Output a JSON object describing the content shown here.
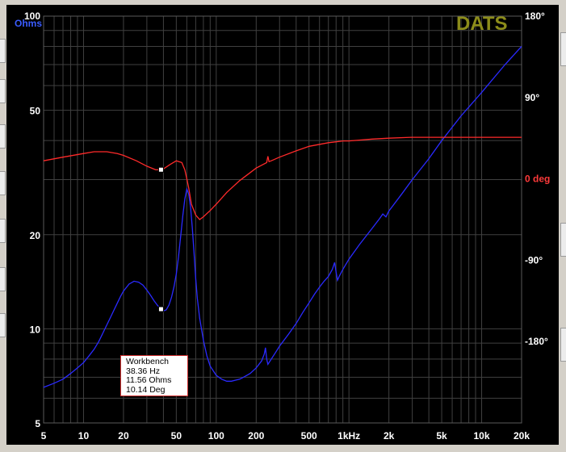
{
  "app": {
    "logo_text": "DATS"
  },
  "colors": {
    "background": "#000000",
    "grid": "#404040",
    "impedance": "#2a2aff",
    "phase": "#ff2a2a",
    "left_label": "#ffffff",
    "ohms_label": "#3a5cff",
    "deg_label": "#ff3a3a",
    "logo": "#8c8c1a"
  },
  "readout": {
    "title": "Workbench",
    "freq": "38.36 Hz",
    "ohms": "11.56 Ohms",
    "deg": "10.14 Deg"
  },
  "chart_data": {
    "type": "line",
    "x_scale": "log",
    "y_scale": "log",
    "xlim": [
      5,
      20000
    ],
    "ylim": [
      5,
      100
    ],
    "y2lim": [
      -270,
      180
    ],
    "grid": true,
    "xlabel": "",
    "ylabel": "Ohms",
    "y2label": "deg",
    "x_tick_labels": [
      {
        "v": 5,
        "t": "5"
      },
      {
        "v": 10,
        "t": "10"
      },
      {
        "v": 20,
        "t": "20"
      },
      {
        "v": 50,
        "t": "50"
      },
      {
        "v": 100,
        "t": "100"
      },
      {
        "v": 200,
        "t": "200"
      },
      {
        "v": 500,
        "t": "500"
      },
      {
        "v": 1000,
        "t": "1kHz"
      },
      {
        "v": 2000,
        "t": "2k"
      },
      {
        "v": 5000,
        "t": "5k"
      },
      {
        "v": 10000,
        "t": "10k"
      },
      {
        "v": 20000,
        "t": "20k"
      }
    ],
    "y_tick_labels": [
      {
        "v": 100,
        "t": "100"
      },
      {
        "v": 50,
        "t": "50"
      },
      {
        "v": 20,
        "t": "20"
      },
      {
        "v": 10,
        "t": "10"
      },
      {
        "v": 5,
        "t": "5"
      }
    ],
    "y2_tick_labels": [
      {
        "v": 180,
        "t": "180°"
      },
      {
        "v": 90,
        "t": "90°"
      },
      {
        "v": 0,
        "t": "0"
      },
      {
        "v": -90,
        "t": "-90°"
      },
      {
        "v": -180,
        "t": "-180°"
      }
    ],
    "series": [
      {
        "name": "Ohms",
        "axis": "left",
        "x": [
          5,
          6,
          7,
          8,
          9,
          10,
          11,
          12,
          13,
          14,
          15,
          16,
          17,
          18,
          19,
          20,
          22,
          24,
          26,
          28,
          30,
          32,
          34,
          36,
          38.36,
          40,
          42,
          44,
          46,
          48,
          50,
          52,
          54,
          56,
          58,
          60,
          62,
          64,
          66,
          68,
          70,
          72,
          75,
          80,
          85,
          90,
          100,
          110,
          120,
          130,
          140,
          150,
          160,
          180,
          200,
          220,
          230,
          235,
          240,
          245,
          250,
          260,
          280,
          300,
          350,
          400,
          450,
          500,
          550,
          600,
          650,
          700,
          750,
          780,
          800,
          820,
          850,
          900,
          1000,
          1200,
          1500,
          1700,
          1800,
          1900,
          2000,
          2500,
          3000,
          4000,
          5000,
          7000,
          10000,
          15000,
          20000
        ],
        "y": [
          6.5,
          6.7,
          6.9,
          7.2,
          7.5,
          7.8,
          8.2,
          8.6,
          9.1,
          9.7,
          10.3,
          10.9,
          11.5,
          12.1,
          12.7,
          13.2,
          13.9,
          14.2,
          14.1,
          13.8,
          13.3,
          12.8,
          12.3,
          11.9,
          11.56,
          11.4,
          11.5,
          11.9,
          12.6,
          13.6,
          15.0,
          17.0,
          19.8,
          23.0,
          26.0,
          28.0,
          27.0,
          24.5,
          21.0,
          17.5,
          14.5,
          12.5,
          10.8,
          9.2,
          8.2,
          7.6,
          7.1,
          6.9,
          6.8,
          6.8,
          6.85,
          6.9,
          7.0,
          7.2,
          7.5,
          7.9,
          8.3,
          8.7,
          8.0,
          7.7,
          7.8,
          8.0,
          8.4,
          8.8,
          9.6,
          10.4,
          11.3,
          12.1,
          12.9,
          13.6,
          14.2,
          14.7,
          15.5,
          16.3,
          15.2,
          14.3,
          14.8,
          15.5,
          16.7,
          18.6,
          21.0,
          22.5,
          23.3,
          22.8,
          23.8,
          27.0,
          30.0,
          35.0,
          40.0,
          48.0,
          57.0,
          70.0,
          80.0
        ]
      },
      {
        "name": "deg",
        "axis": "right",
        "x": [
          5,
          7,
          10,
          12,
          15,
          18,
          20,
          25,
          30,
          35,
          38.36,
          40,
          45,
          50,
          55,
          58,
          60,
          62,
          65,
          70,
          75,
          80,
          90,
          100,
          120,
          150,
          200,
          240,
          245,
          250,
          260,
          300,
          400,
          500,
          700,
          800,
          900,
          1000,
          1500,
          2000,
          3000,
          5000,
          10000,
          20000
        ],
        "y": [
          20,
          24,
          28,
          30,
          30,
          28,
          26,
          20,
          14,
          10,
          10.14,
          11,
          16,
          20,
          18,
          10,
          0,
          -10,
          -28,
          -40,
          -45,
          -42,
          -35,
          -28,
          -15,
          -2,
          12,
          18,
          25,
          19,
          20,
          24,
          31,
          36,
          40,
          41,
          42,
          42,
          44,
          45,
          46,
          46,
          46,
          46
        ]
      }
    ],
    "marker": {
      "x": 38.36,
      "y": 11.56,
      "phase": 10.14
    }
  }
}
